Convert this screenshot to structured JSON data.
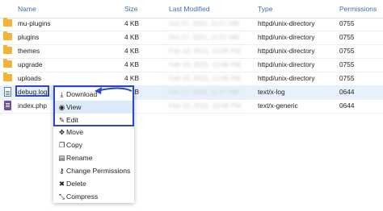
{
  "columns": {
    "name": "Name",
    "size": "Size",
    "modified": "Last Modified",
    "type": "Type",
    "permissions": "Permissions"
  },
  "rows": [
    {
      "name": "mu-plugins",
      "size": "4 KB",
      "modified": "Oct 27, 2021, 11:57 AM",
      "type": "httpd/unix-directory",
      "permissions": "0755",
      "icon": "folder-icon"
    },
    {
      "name": "plugins",
      "size": "4 KB",
      "modified": "Oct 27, 2021, 11:57 AM",
      "type": "httpd/unix-directory",
      "permissions": "0755",
      "icon": "folder-icon"
    },
    {
      "name": "themes",
      "size": "4 KB",
      "modified": "Feb 10, 2021, 12:05 PM",
      "type": "httpd/unix-directory",
      "permissions": "0755",
      "icon": "folder-icon"
    },
    {
      "name": "upgrade",
      "size": "4 KB",
      "modified": "Feb 10, 2021, 12:06 PM",
      "type": "httpd/unix-directory",
      "permissions": "0755",
      "icon": "folder-icon"
    },
    {
      "name": "uploads",
      "size": "4 KB",
      "modified": "Feb 10, 2021, 12:06 PM",
      "type": "httpd/unix-directory",
      "permissions": "0755",
      "icon": "folder-icon"
    },
    {
      "name": "debug.log",
      "size": "4 KB",
      "modified": "Oct 27, 2021, 11:57 AM",
      "type": "text/x-log",
      "permissions": "0644",
      "icon": "log-file-icon"
    },
    {
      "name": "index.php",
      "size": "bytes",
      "modified": "Feb 10, 2021, 12:06 PM",
      "type": "text/x-generic",
      "permissions": "0644",
      "icon": "php-file-icon"
    }
  ],
  "context_menu": {
    "items": [
      {
        "label": "Download",
        "icon": "download-icon",
        "glyph": "⤓"
      },
      {
        "label": "View",
        "icon": "eye-icon",
        "glyph": "◉"
      },
      {
        "label": "Edit",
        "icon": "pencil-icon",
        "glyph": "✎"
      },
      {
        "label": "Move",
        "icon": "move-icon",
        "glyph": "✥"
      },
      {
        "label": "Copy",
        "icon": "copy-icon",
        "glyph": "❐"
      },
      {
        "label": "Rename",
        "icon": "rename-icon",
        "glyph": "▤"
      },
      {
        "label": "Change Permissions",
        "icon": "key-icon",
        "glyph": "⚷"
      },
      {
        "label": "Delete",
        "icon": "delete-icon",
        "glyph": "✖"
      },
      {
        "label": "Compress",
        "icon": "compress-icon",
        "glyph": "⤡"
      }
    ]
  },
  "colors": {
    "header_text": "#3d6fb0",
    "highlight_box": "#2c47c8",
    "selected_row": "#e8f1fb",
    "folder": "#f2b337"
  }
}
